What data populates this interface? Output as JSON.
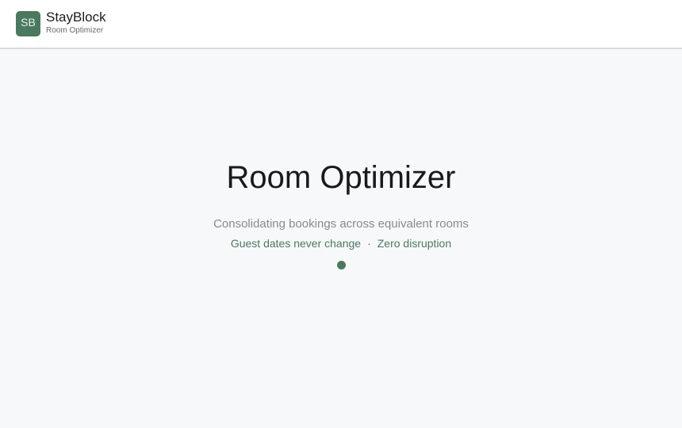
{
  "header": {
    "logo_text": "SB",
    "brand_name": "StayBlock",
    "brand_subtitle": "Room Optimizer"
  },
  "main": {
    "title": "Room Optimizer",
    "subtitle": "Consolidating bookings across equivalent rooms",
    "tagline_left": "Guest dates never change",
    "tagline_separator": "·",
    "tagline_right": "Zero disruption",
    "loading_indicator": "loading-dot-icon"
  },
  "colors": {
    "accent": "#4a7a5e",
    "background": "#f7f8fa",
    "header_bg": "#ffffff",
    "title": "#1a1a1a",
    "muted": "#8a8a8a"
  }
}
